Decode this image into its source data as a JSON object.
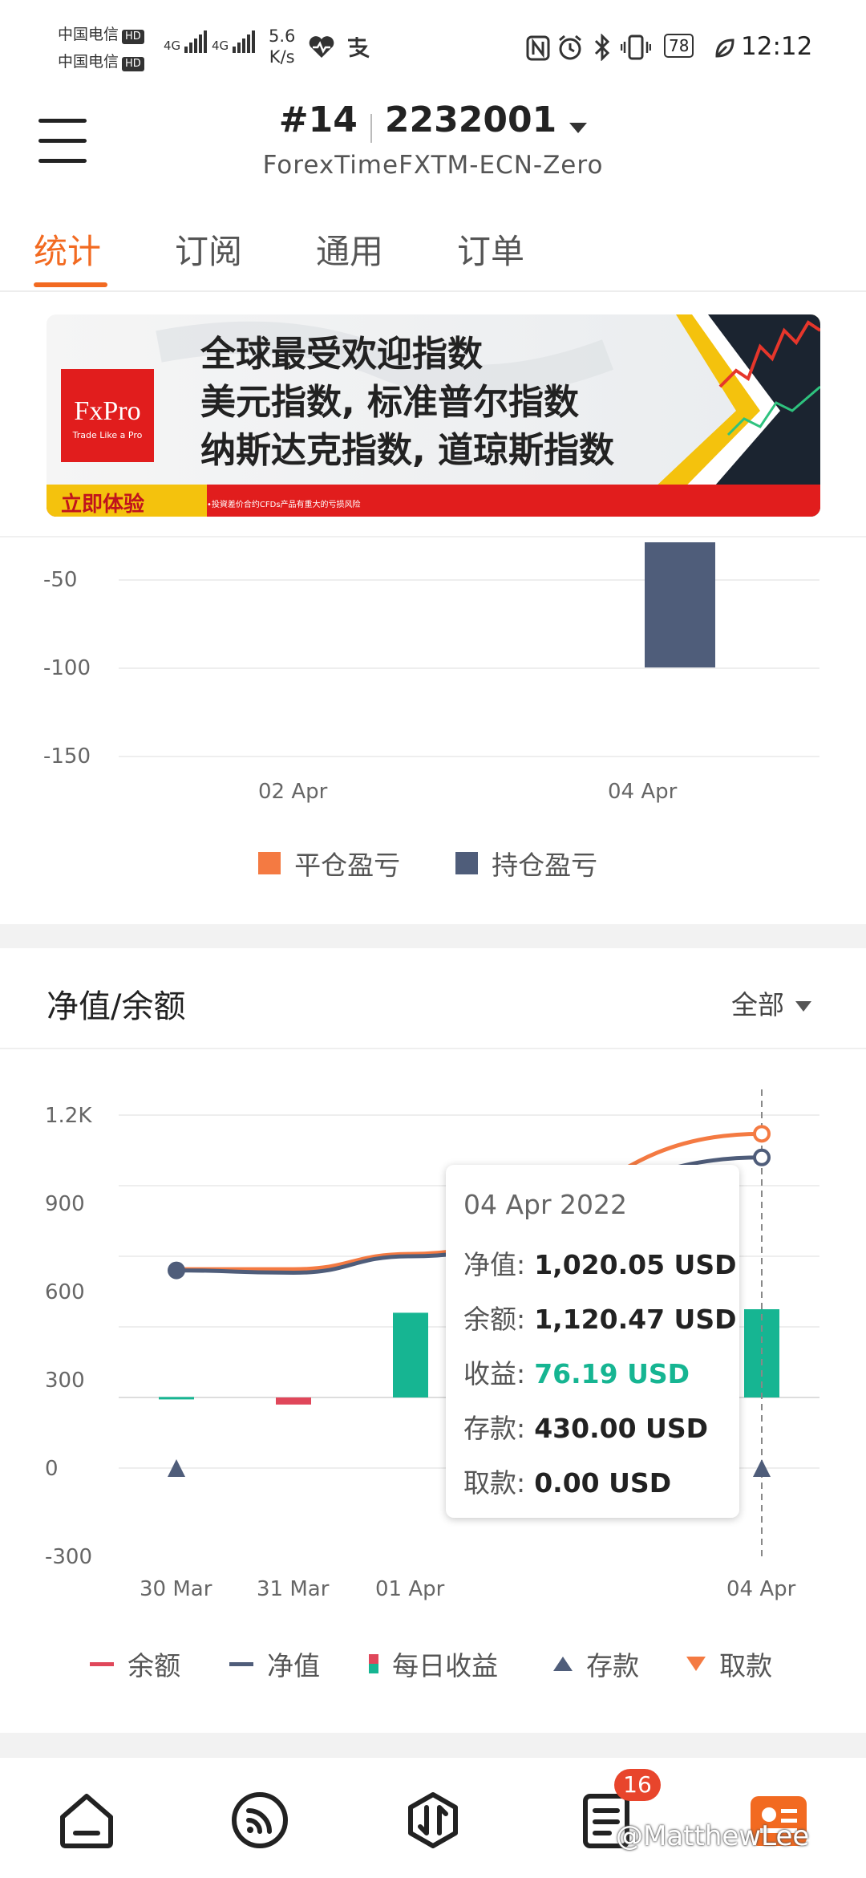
{
  "status_bar": {
    "carrier1": "中国电信",
    "carrier2": "中国电信",
    "hd": "HD",
    "net1": "4G",
    "net2": "4G",
    "speed_value": "5.6",
    "speed_unit": "K/s",
    "battery": "78",
    "time": "12:12"
  },
  "header": {
    "account_index": "#14",
    "account_number": "2232001",
    "server": "ForexTimeFXTM-ECN-Zero"
  },
  "tabs": [
    {
      "label": "统计",
      "active": true
    },
    {
      "label": "订阅",
      "active": false
    },
    {
      "label": "通用",
      "active": false
    },
    {
      "label": "订单",
      "active": false
    }
  ],
  "banner": {
    "brand": "FxPro",
    "brand_tagline": "Trade Like a Pro",
    "line1": "全球最受欢迎指数",
    "line2": "美元指数, 标准普尔指数",
    "line3": "纳斯达克指数, 道琼斯指数",
    "cta": "立即体验",
    "disclaimer": "•投資差价合约CFDs产品有重大的亏损风险"
  },
  "colors": {
    "accent": "#f26a21",
    "orange_line": "#f47a42",
    "navy": "#4f5d7a",
    "teal": "#16b592",
    "red": "#e0475a"
  },
  "chart_data": [
    {
      "type": "bar",
      "y_ticks": [
        "-50",
        "-100",
        "-150"
      ],
      "ylim": [
        -165,
        -25
      ],
      "x_ticks": [
        "02 Apr",
        "04 Apr"
      ],
      "series": [
        {
          "name": "平仓盈亏",
          "color": "#f47a42",
          "values": []
        },
        {
          "name": "持仓盈亏",
          "color": "#4f5d7a",
          "values": [
            {
              "x": "04 Apr",
              "y": -100
            }
          ]
        }
      ]
    },
    {
      "type": "line",
      "title": "净值/余额",
      "filter": "全部",
      "y_ticks": [
        "1.2K",
        "900",
        "600",
        "300",
        "0",
        "-300"
      ],
      "ylim": [
        -300,
        1200
      ],
      "x_ticks": [
        "30 Mar",
        "31 Mar",
        "01 Apr",
        "04 Apr"
      ],
      "series": [
        {
          "name": "余额",
          "color": "#f47a42",
          "type": "line",
          "values": [
            {
              "x": "30 Mar",
              "y": 545
            },
            {
              "x": "31 Mar",
              "y": 545
            },
            {
              "x": "01 Apr",
              "y": 610
            },
            {
              "x": "04 Apr",
              "y": 1120.47
            }
          ]
        },
        {
          "name": "净值",
          "color": "#4f5d7a",
          "type": "line",
          "values": [
            {
              "x": "30 Mar",
              "y": 540
            },
            {
              "x": "31 Mar",
              "y": 530
            },
            {
              "x": "01 Apr",
              "y": 600
            },
            {
              "x": "04 Apr",
              "y": 1020.05
            }
          ]
        },
        {
          "name": "每日收益",
          "color": "#16b592",
          "type": "bar",
          "values": [
            {
              "x": "30 Mar",
              "y": 2
            },
            {
              "x": "31 Mar",
              "y": -30
            },
            {
              "x": "01 Apr",
              "y": 360
            },
            {
              "x": "04 Apr",
              "y": 375
            }
          ]
        },
        {
          "name": "存款",
          "type": "marker",
          "values": [
            "30 Mar",
            "02 Apr",
            "04 Apr"
          ]
        },
        {
          "name": "取款",
          "type": "marker",
          "values": []
        }
      ],
      "tooltip": {
        "date": "04 Apr 2022",
        "rows": [
          {
            "label": "净值:",
            "value": "1,020.05 USD",
            "color": "#222222"
          },
          {
            "label": "余额:",
            "value": "1,120.47 USD",
            "color": "#222222"
          },
          {
            "label": "收益:",
            "value": "76.19 USD",
            "color": "#16b592"
          },
          {
            "label": "存款:",
            "value": "430.00 USD",
            "color": "#222222"
          },
          {
            "label": "取款:",
            "value": "0.00 USD",
            "color": "#222222"
          }
        ]
      }
    }
  ],
  "bottom_nav": {
    "items": [
      "home-icon",
      "feed-icon",
      "trade-icon",
      "orders-icon",
      "profile-icon"
    ],
    "badge": "16",
    "watermark": "@MatthewLee"
  }
}
